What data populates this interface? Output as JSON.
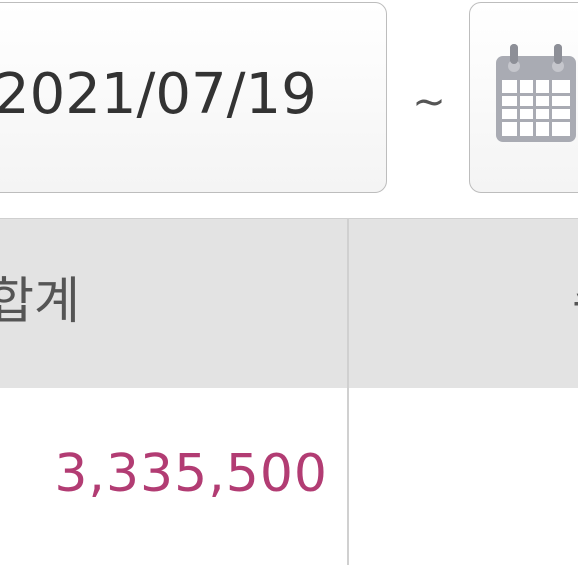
{
  "date_range": {
    "start_date": "2021/07/19",
    "separator": "~",
    "end_date": ""
  },
  "icons": {
    "calendar": "calendar-icon"
  },
  "colors": {
    "amount_text": "#b23c73",
    "header_bg": "#e3e3e3",
    "box_border": "#bdbdbd",
    "icon_gray": "#a9abb3"
  },
  "table": {
    "columns": [
      "합계",
      "수"
    ],
    "rows": [
      {
        "total": "3,335,500",
        "next": ""
      }
    ]
  }
}
